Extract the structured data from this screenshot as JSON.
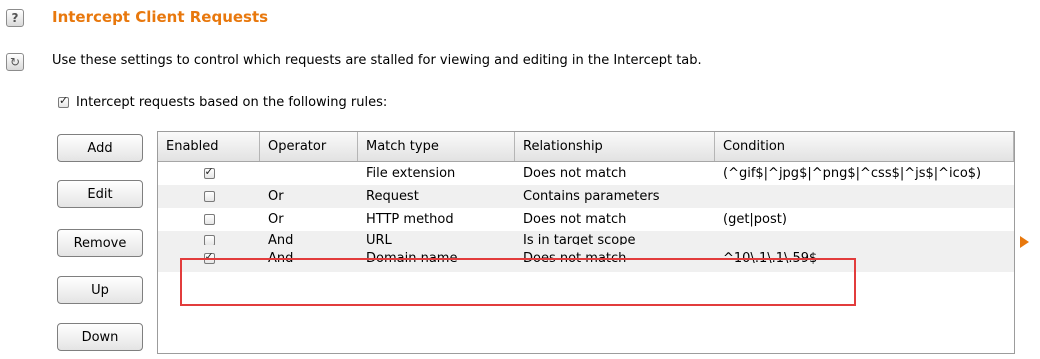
{
  "header": {
    "title": "Intercept Client Requests",
    "description": "Use these settings to control which requests are stalled for viewing and editing in the Intercept tab."
  },
  "master_rule": {
    "checked": true,
    "label": "Intercept requests based on the following rules:"
  },
  "buttons": {
    "add": "Add",
    "edit": "Edit",
    "remove": "Remove",
    "up": "Up",
    "down": "Down"
  },
  "table": {
    "columns": [
      "Enabled",
      "Operator",
      "Match type",
      "Relationship",
      "Condition"
    ],
    "rows": [
      {
        "enabled": true,
        "operator": "",
        "match_type": "File extension",
        "relationship": "Does not match",
        "condition": "(^gif$|^jpg$|^png$|^css$|^js$|^ico$)"
      },
      {
        "enabled": false,
        "operator": "Or",
        "match_type": "Request",
        "relationship": "Contains parameters",
        "condition": ""
      },
      {
        "enabled": false,
        "operator": "Or",
        "match_type": "HTTP method",
        "relationship": "Does not match",
        "condition": "(get|post)"
      },
      {
        "enabled": false,
        "operator": "And",
        "match_type": "URL",
        "relationship": "Is in target scope",
        "condition": ""
      },
      {
        "enabled": true,
        "operator": "And",
        "match_type": "Domain name",
        "relationship": "Does not match",
        "condition": "^10\\.1\\.1\\.59$"
      }
    ]
  },
  "icons": {
    "help": "help-icon",
    "refresh": "refresh-icon",
    "expand": "expand-arrow-icon"
  },
  "colors": {
    "title": "#e8780d",
    "highlight_border": "#e23c3c"
  }
}
